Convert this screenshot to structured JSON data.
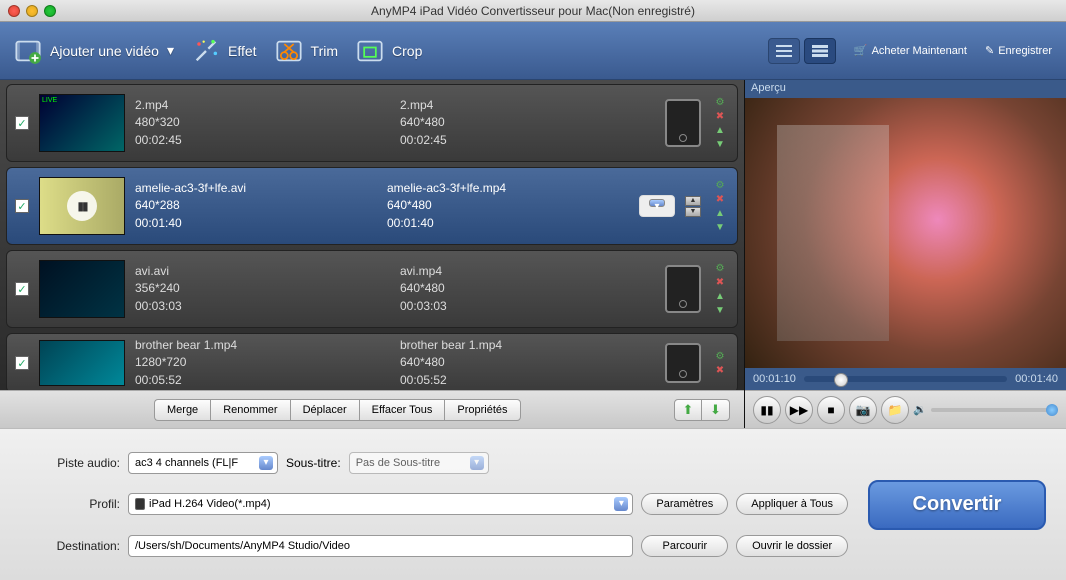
{
  "window": {
    "title": "AnyMP4 iPad Vidéo Convertisseur pour Mac(Non enregistré)"
  },
  "toolbar": {
    "add": "Ajouter une vidéo",
    "effect": "Effet",
    "trim": "Trim",
    "crop": "Crop",
    "buy": "Acheter Maintenant",
    "register": "Enregistrer"
  },
  "files": [
    {
      "src_name": "2.mp4",
      "src_res": "480*320",
      "src_dur": "00:02:45",
      "out_name": "2.mp4",
      "out_res": "640*480",
      "out_dur": "00:02:45",
      "selected": false
    },
    {
      "src_name": "amelie-ac3-3f+lfe.avi",
      "src_res": "640*288",
      "src_dur": "00:01:40",
      "out_name": "amelie-ac3-3f+lfe.mp4",
      "out_res": "640*480",
      "out_dur": "00:01:40",
      "selected": true
    },
    {
      "src_name": "avi.avi",
      "src_res": "356*240",
      "src_dur": "00:03:03",
      "out_name": "avi.mp4",
      "out_res": "640*480",
      "out_dur": "00:03:03",
      "selected": false
    },
    {
      "src_name": "brother bear 1.mp4",
      "src_res": "1280*720",
      "src_dur": "00:05:52",
      "out_name": "brother bear 1.mp4",
      "out_res": "640*480",
      "out_dur": "00:05:52",
      "selected": false
    }
  ],
  "listbar": {
    "merge": "Merge",
    "rename": "Renommer",
    "move": "Déplacer",
    "clear": "Effacer Tous",
    "props": "Propriétés"
  },
  "preview": {
    "title": "Aperçu",
    "cur": "00:01:10",
    "total": "00:01:40"
  },
  "settings": {
    "audio_label": "Piste audio:",
    "audio_value": "ac3 4 channels (FL|F",
    "subtitle_label": "Sous-titre:",
    "subtitle_value": "Pas de Sous-titre",
    "profile_label": "Profil:",
    "profile_value": "iPad H.264 Video(*.mp4)",
    "dest_label": "Destination:",
    "dest_value": "/Users/sh/Documents/AnyMP4 Studio/Video",
    "params": "Paramètres",
    "apply_all": "Appliquer à Tous",
    "browse": "Parcourir",
    "open_folder": "Ouvrir le dossier"
  },
  "convert": "Convertir"
}
